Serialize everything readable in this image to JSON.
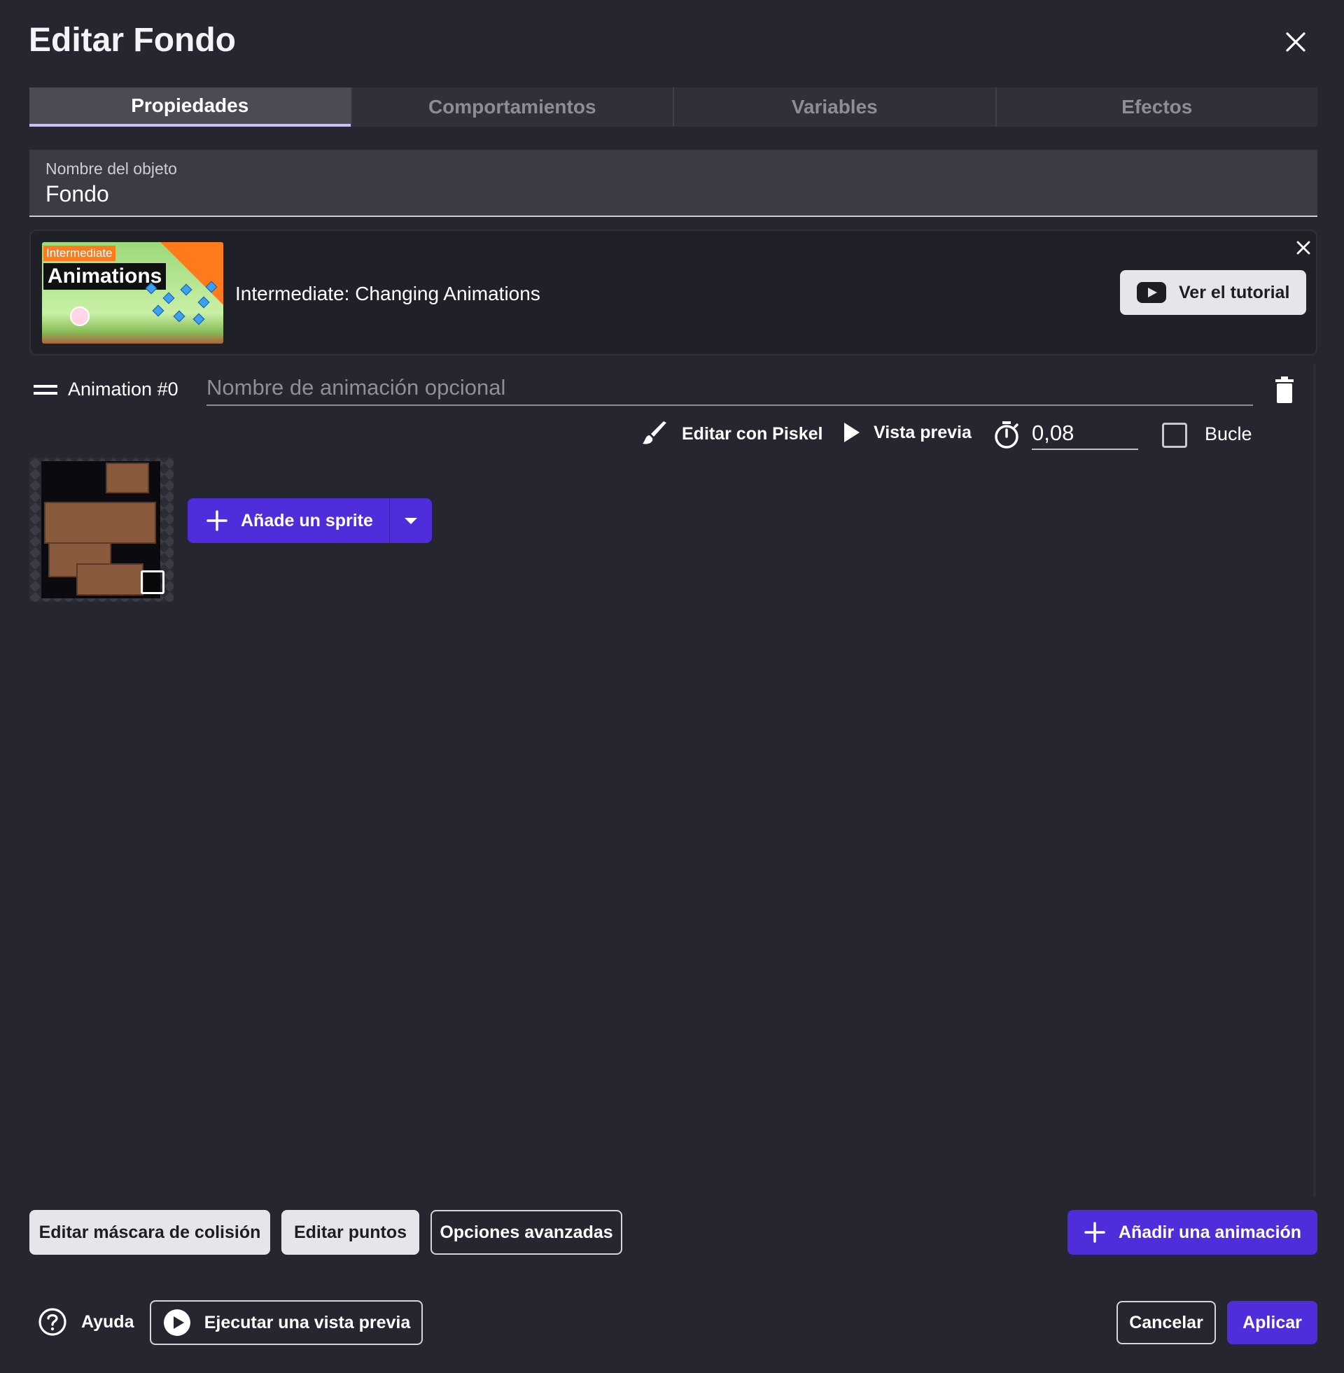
{
  "dialog": {
    "title": "Editar Fondo"
  },
  "tabs": [
    {
      "label": "Propiedades",
      "active": true
    },
    {
      "label": "Comportamientos",
      "active": false
    },
    {
      "label": "Variables",
      "active": false
    },
    {
      "label": "Efectos",
      "active": false
    }
  ],
  "object_name": {
    "label": "Nombre del objeto",
    "value": "Fondo"
  },
  "tutorial": {
    "thumbnail_badge": "Intermediate",
    "thumbnail_title": "Animations",
    "title": "Intermediate: Changing Animations",
    "watch_label": "Ver el tutorial"
  },
  "animation": {
    "label": "Animation #0",
    "name_placeholder": "Nombre de animación opcional",
    "edit_piskel_label": "Editar con Piskel",
    "preview_label": "Vista previa",
    "timer_value": "0,08",
    "loop_label": "Bucle",
    "loop_checked": false,
    "sprite_selected": false,
    "add_sprite_label": "Añade un sprite"
  },
  "actions": {
    "collision_mask": "Editar máscara de colisión",
    "edit_points": "Editar puntos",
    "advanced": "Opciones avanzadas",
    "add_animation": "Añadir una animación"
  },
  "footer": {
    "help": "Ayuda",
    "run_preview": "Ejecutar una vista previa",
    "cancel": "Cancelar",
    "apply": "Aplicar"
  },
  "colors": {
    "background": "#25262f",
    "accent": "#4f2ddb",
    "tab_active_underline": "#c9c2f5"
  }
}
